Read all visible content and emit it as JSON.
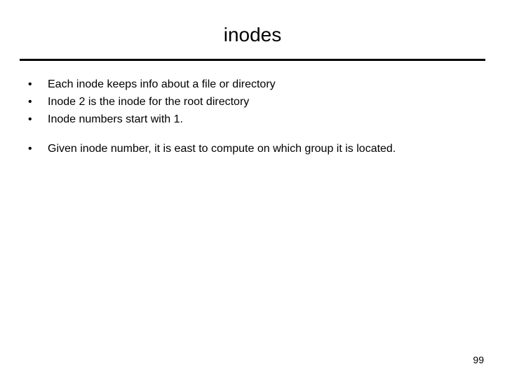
{
  "title": "inodes",
  "bullets_group1": [
    "Each inode keeps info about a file or directory",
    "Inode 2 is the inode for the root directory",
    "Inode numbers start with 1."
  ],
  "bullets_group2": [
    "Given inode number, it is east to compute on which group it is located."
  ],
  "page_number": "99",
  "bullet_glyph": "•"
}
